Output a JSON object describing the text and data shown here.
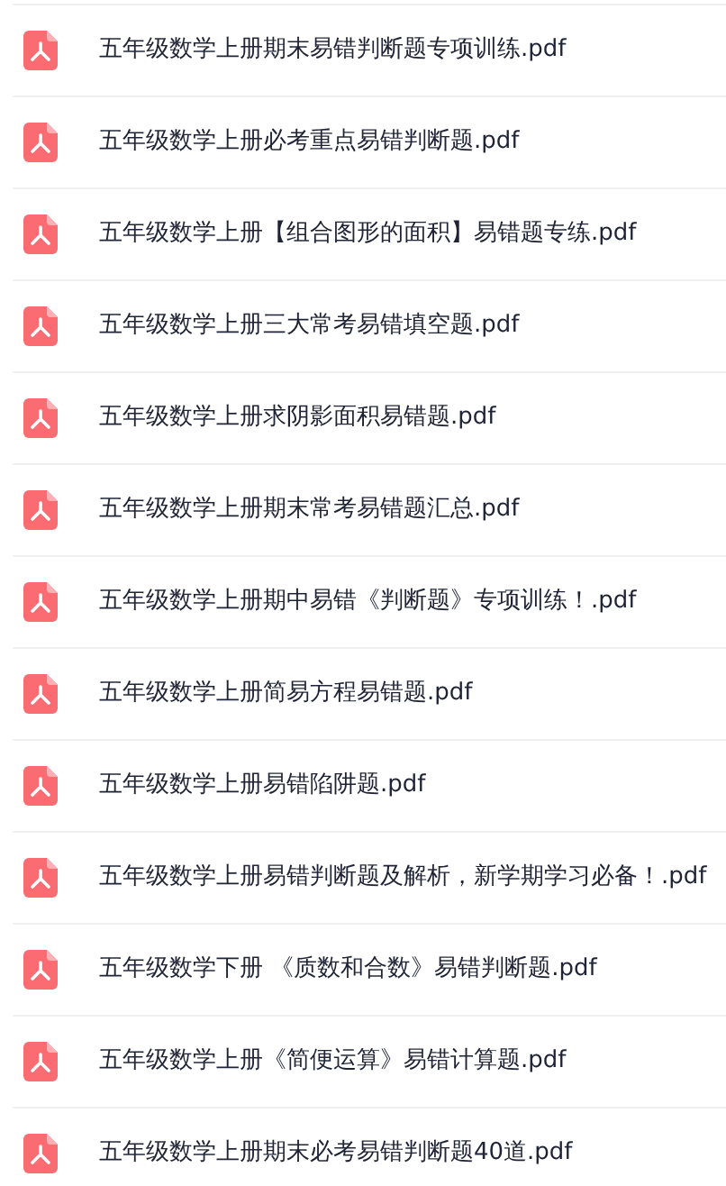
{
  "files": [
    {
      "name": "五年级数学上册期末易错判断题专项训练.pdf"
    },
    {
      "name": "五年级数学上册必考重点易错判断题.pdf"
    },
    {
      "name": "五年级数学上册【组合图形的面积】易错题专练.pdf"
    },
    {
      "name": "五年级数学上册三大常考易错填空题.pdf"
    },
    {
      "name": "五年级数学上册求阴影面积易错题.pdf"
    },
    {
      "name": "五年级数学上册期末常考易错题汇总.pdf"
    },
    {
      "name": "五年级数学上册期中易错《判断题》专项训练！.pdf"
    },
    {
      "name": "五年级数学上册简易方程易错题.pdf"
    },
    {
      "name": "五年级数学上册易错陷阱题.pdf"
    },
    {
      "name": "五年级数学上册易错判断题及解析，新学期学习必备！.pdf"
    },
    {
      "name": "五年级数学下册 《质数和合数》易错判断题.pdf"
    },
    {
      "name": "五年级数学上册《简便运算》易错计算题.pdf"
    },
    {
      "name": "五年级数学上册期末必考易错判断题40道.pdf"
    }
  ]
}
